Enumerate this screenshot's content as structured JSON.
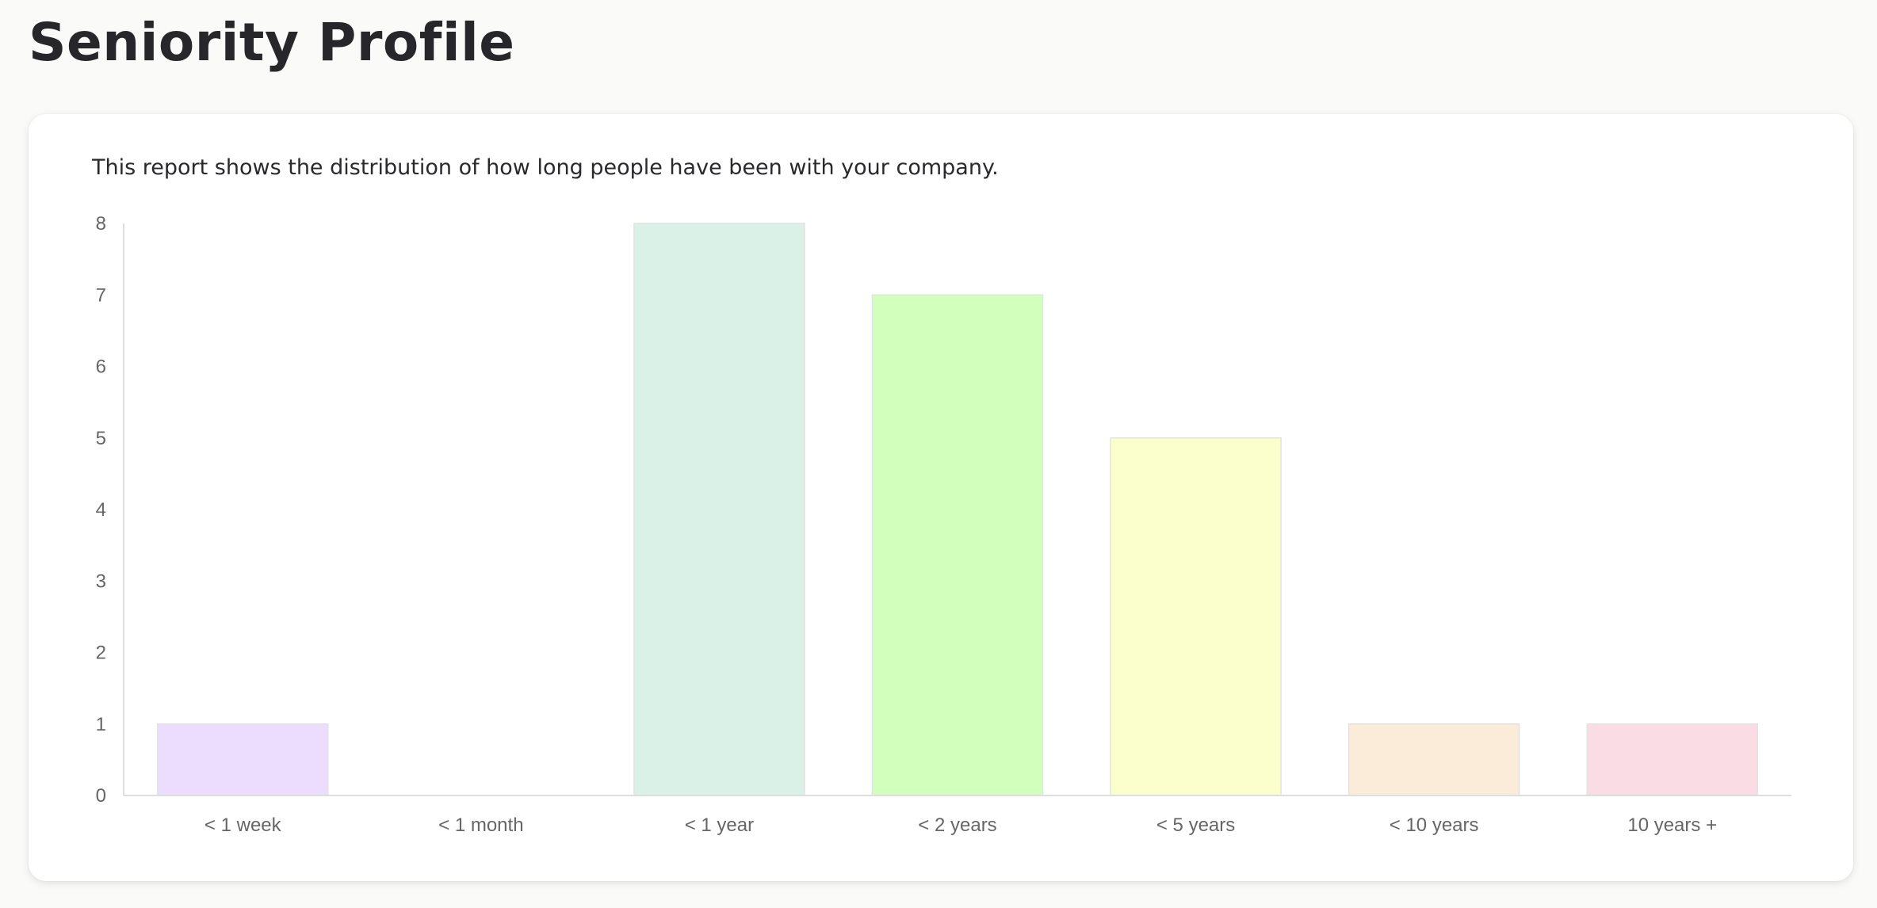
{
  "page": {
    "title": "Seniority Profile",
    "description": "This report shows the distribution of how long people have been with your company."
  },
  "chart_data": {
    "type": "bar",
    "categories": [
      "< 1 week",
      "< 1 month",
      "< 1 year",
      "< 2 years",
      "< 5 years",
      "< 10 years",
      "10 years +"
    ],
    "values": [
      1,
      0,
      8,
      7,
      5,
      1,
      1
    ],
    "colors": [
      "#ecdcfd",
      "#ffffff",
      "#daf1e7",
      "#d3ffbd",
      "#fbffcc",
      "#fbebd9",
      "#fadce5"
    ],
    "title": "",
    "xlabel": "",
    "ylabel": "",
    "ylim": [
      0,
      8
    ],
    "yticks": [
      0,
      1,
      2,
      3,
      4,
      5,
      6,
      7,
      8
    ],
    "grid": false,
    "legend": "none"
  }
}
